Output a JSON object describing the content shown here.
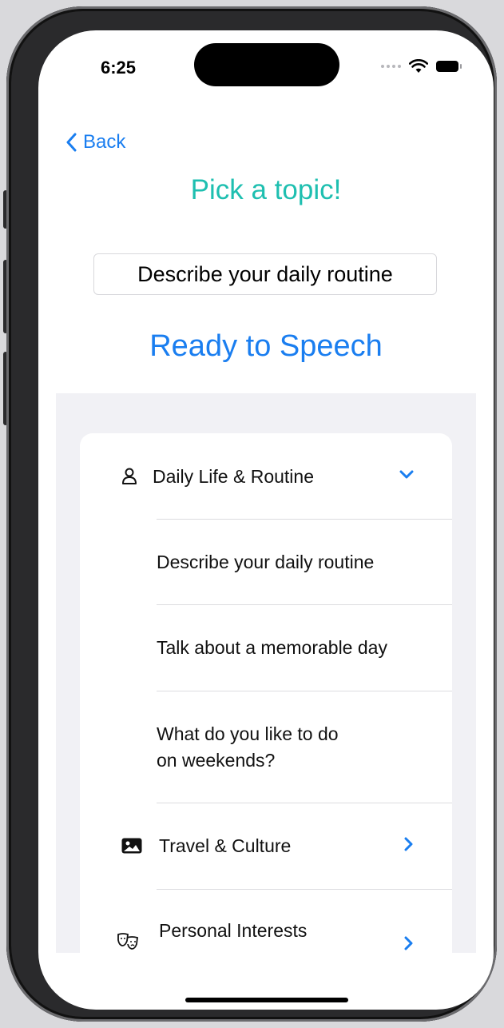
{
  "status_bar": {
    "time": "6:25"
  },
  "nav": {
    "back_label": "Back"
  },
  "header": {
    "title": "Pick a topic!",
    "selected_topic": "Describe your daily routine",
    "action_label": "Ready to Speech"
  },
  "colors": {
    "accent_blue": "#1a7ef0",
    "title_teal": "#1ebfb0",
    "grouped_bg": "#f1f1f5"
  },
  "sections": [
    {
      "label": "Daily Life & Routine",
      "icon": "person-icon",
      "expanded": true,
      "topics": [
        {
          "label": "Describe your daily routine"
        },
        {
          "label": "Talk about a memorable day"
        },
        {
          "label_line1": "What do you like to do",
          "label_line2": "on weekends?"
        }
      ]
    },
    {
      "label": "Travel & Culture",
      "icon": "photo-icon",
      "expanded": false
    },
    {
      "label": "Personal Interests",
      "icon": "theater-masks-icon",
      "expanded": false
    }
  ]
}
